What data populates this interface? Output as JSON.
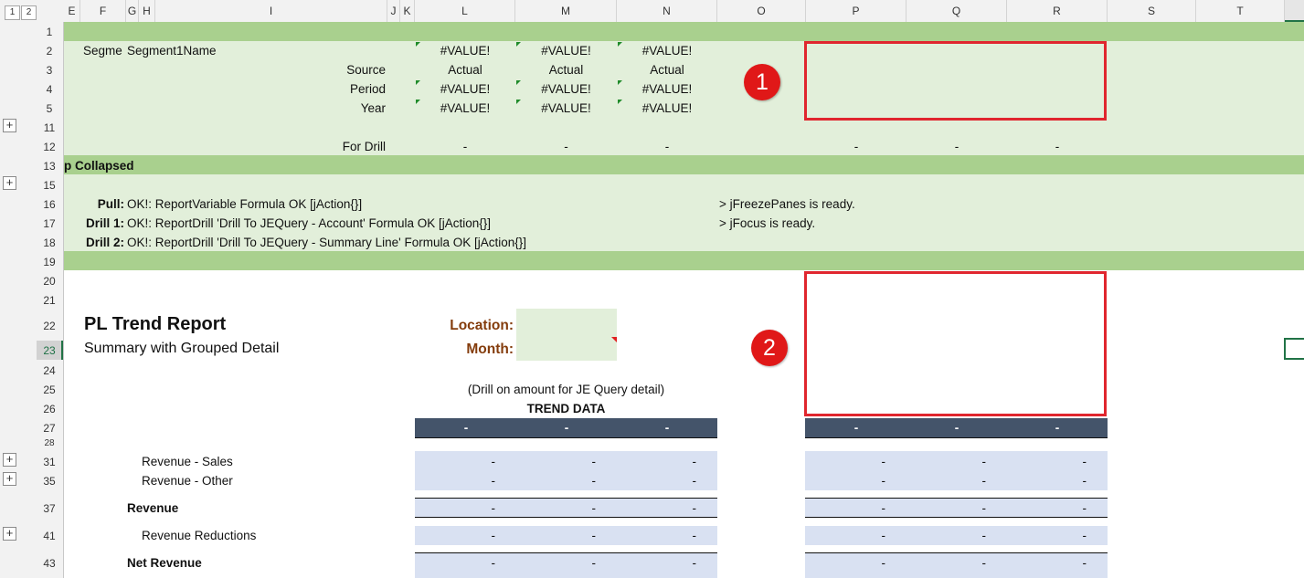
{
  "outline_levels": [
    "1",
    "2"
  ],
  "columns": [
    "E",
    "F",
    "G",
    "H",
    "I",
    "J",
    "K",
    "L",
    "M",
    "N",
    "O",
    "P",
    "Q",
    "R",
    "S",
    "T"
  ],
  "rows": [
    "1",
    "2",
    "3",
    "4",
    "5",
    "11",
    "12",
    "13",
    "15",
    "16",
    "17",
    "18",
    "19",
    "20",
    "21",
    "22",
    "23",
    "24",
    "25",
    "26",
    "27",
    "28",
    "31",
    "35",
    "37",
    "41",
    "43"
  ],
  "top_panel": {
    "segment_label": "Segme",
    "segment_name": "Segment1Name",
    "labels": {
      "source": "Source",
      "period": "Period",
      "year": "Year",
      "for_drill": "For Drill"
    },
    "value_error": "#VALUE!",
    "source_actual": "Actual",
    "dash": "-",
    "group_collapsed": "p Collapsed",
    "pull_label": "Pull:",
    "pull_text": "OK!: ReportVariable Formula OK [jAction{}]",
    "drill1_label": "Drill 1:",
    "drill1_text": "OK!: ReportDrill 'Drill To JEQuery - Account' Formula OK [jAction{}]",
    "drill2_label": "Drill 2:",
    "drill2_text": "OK!: ReportDrill 'Drill To JEQuery - Summary Line' Formula OK [jAction{}]",
    "status1": "> jFreezePanes is ready.",
    "status2": "> jFocus is ready."
  },
  "report": {
    "title": "PL Trend Report",
    "subtitle": "Summary with Grouped Detail",
    "location_label": "Location:",
    "month_label": "Month:",
    "drill_note": "(Drill on amount for JE Query detail)",
    "trend_header": "TREND DATA",
    "lines": [
      {
        "label": "Revenue - Sales",
        "bold": false
      },
      {
        "label": "Revenue - Other",
        "bold": false
      },
      {
        "label": "Revenue",
        "bold": true
      },
      {
        "label": "Revenue Reductions",
        "bold": false
      },
      {
        "label": "Net Revenue",
        "bold": true
      }
    ],
    "dash": "-"
  },
  "annotations": {
    "badge1": "1",
    "badge2": "2"
  },
  "colors": {
    "band_dark": "#a9d08e",
    "band_light": "#e2efda",
    "header_bar": "#44546a",
    "data_fill": "#d9e1f2",
    "annotation_red": "#e0262e",
    "label_brown": "#843c0c"
  }
}
